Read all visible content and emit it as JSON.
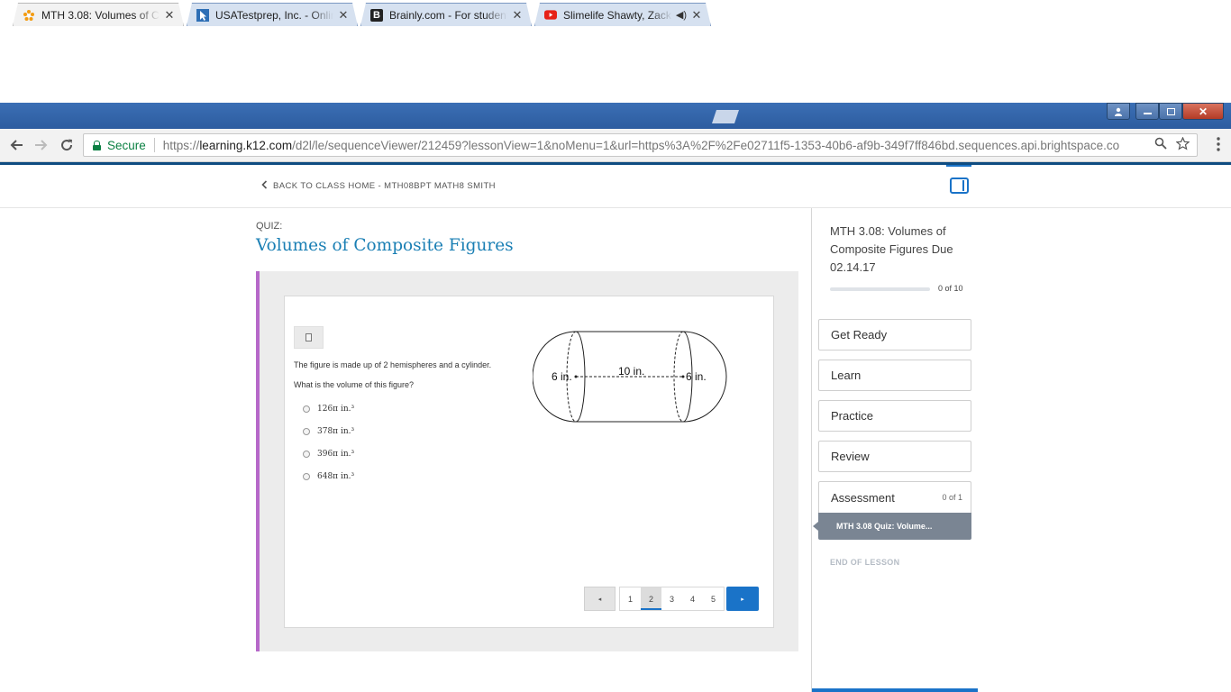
{
  "browser": {
    "tabs": [
      {
        "title": "MTH 3.08: Volumes of Co",
        "favicon": "k12-flower-icon",
        "active": true
      },
      {
        "title": "USATestprep, Inc. - Onlin",
        "favicon": "cursor-arrow-icon",
        "active": false
      },
      {
        "title": "Brainly.com - For student",
        "favicon": "brainly-b-icon",
        "active": false
      },
      {
        "title": "Slimelife Shawty, Zack",
        "favicon": "youtube-icon",
        "active": false
      }
    ],
    "close_glyph": "✕",
    "audio_glyph": "◀)",
    "address": {
      "secure_label": "Secure",
      "url_scheme": "https://",
      "url_host": "learning.k12.com",
      "url_rest": "/d2l/le/sequenceViewer/212459?lessonView=1&noMenu=1&url=https%3A%2F%2Fe02711f5-1353-40b6-af9b-349f7ff846bd.sequences.api.brightspace.co"
    }
  },
  "header": {
    "back_link": "BACK TO CLASS HOME - MTH08BPT MATH8 SMITH"
  },
  "main": {
    "quiz_label": "QUIZ:",
    "quiz_title": "Volumes of Composite Figures",
    "question": {
      "text1": "The figure is made up of 2 hemispheres and a cylinder.",
      "text2": "What is the volume of this figure?",
      "choices": [
        "126π in.³",
        "378π in.³",
        "396π in.³",
        "648π in.³"
      ],
      "figure_labels": {
        "left": "6 in.",
        "middle": "10 in.",
        "right": "6 in."
      }
    },
    "pager": {
      "prev": "◂",
      "pages": [
        "1",
        "2",
        "3",
        "4",
        "5"
      ],
      "current_page": "2",
      "next": "▸"
    }
  },
  "sidebar": {
    "title": "MTH 3.08: Volumes of Composite Figures Due 02.14.17",
    "progress_text": "0 of 10",
    "progress_fraction": 0,
    "items": [
      {
        "label": "Get Ready"
      },
      {
        "label": "Learn"
      },
      {
        "label": "Practice"
      },
      {
        "label": "Review"
      },
      {
        "label": "Assessment",
        "count": "0 of 1"
      }
    ],
    "subitem": "MTH 3.08 Quiz: Volume...",
    "end_label": "END OF LESSON"
  },
  "colors": {
    "accent": "#1a73c8",
    "title_blue": "#1a7fb4",
    "frame_accent": "#b668c9"
  }
}
